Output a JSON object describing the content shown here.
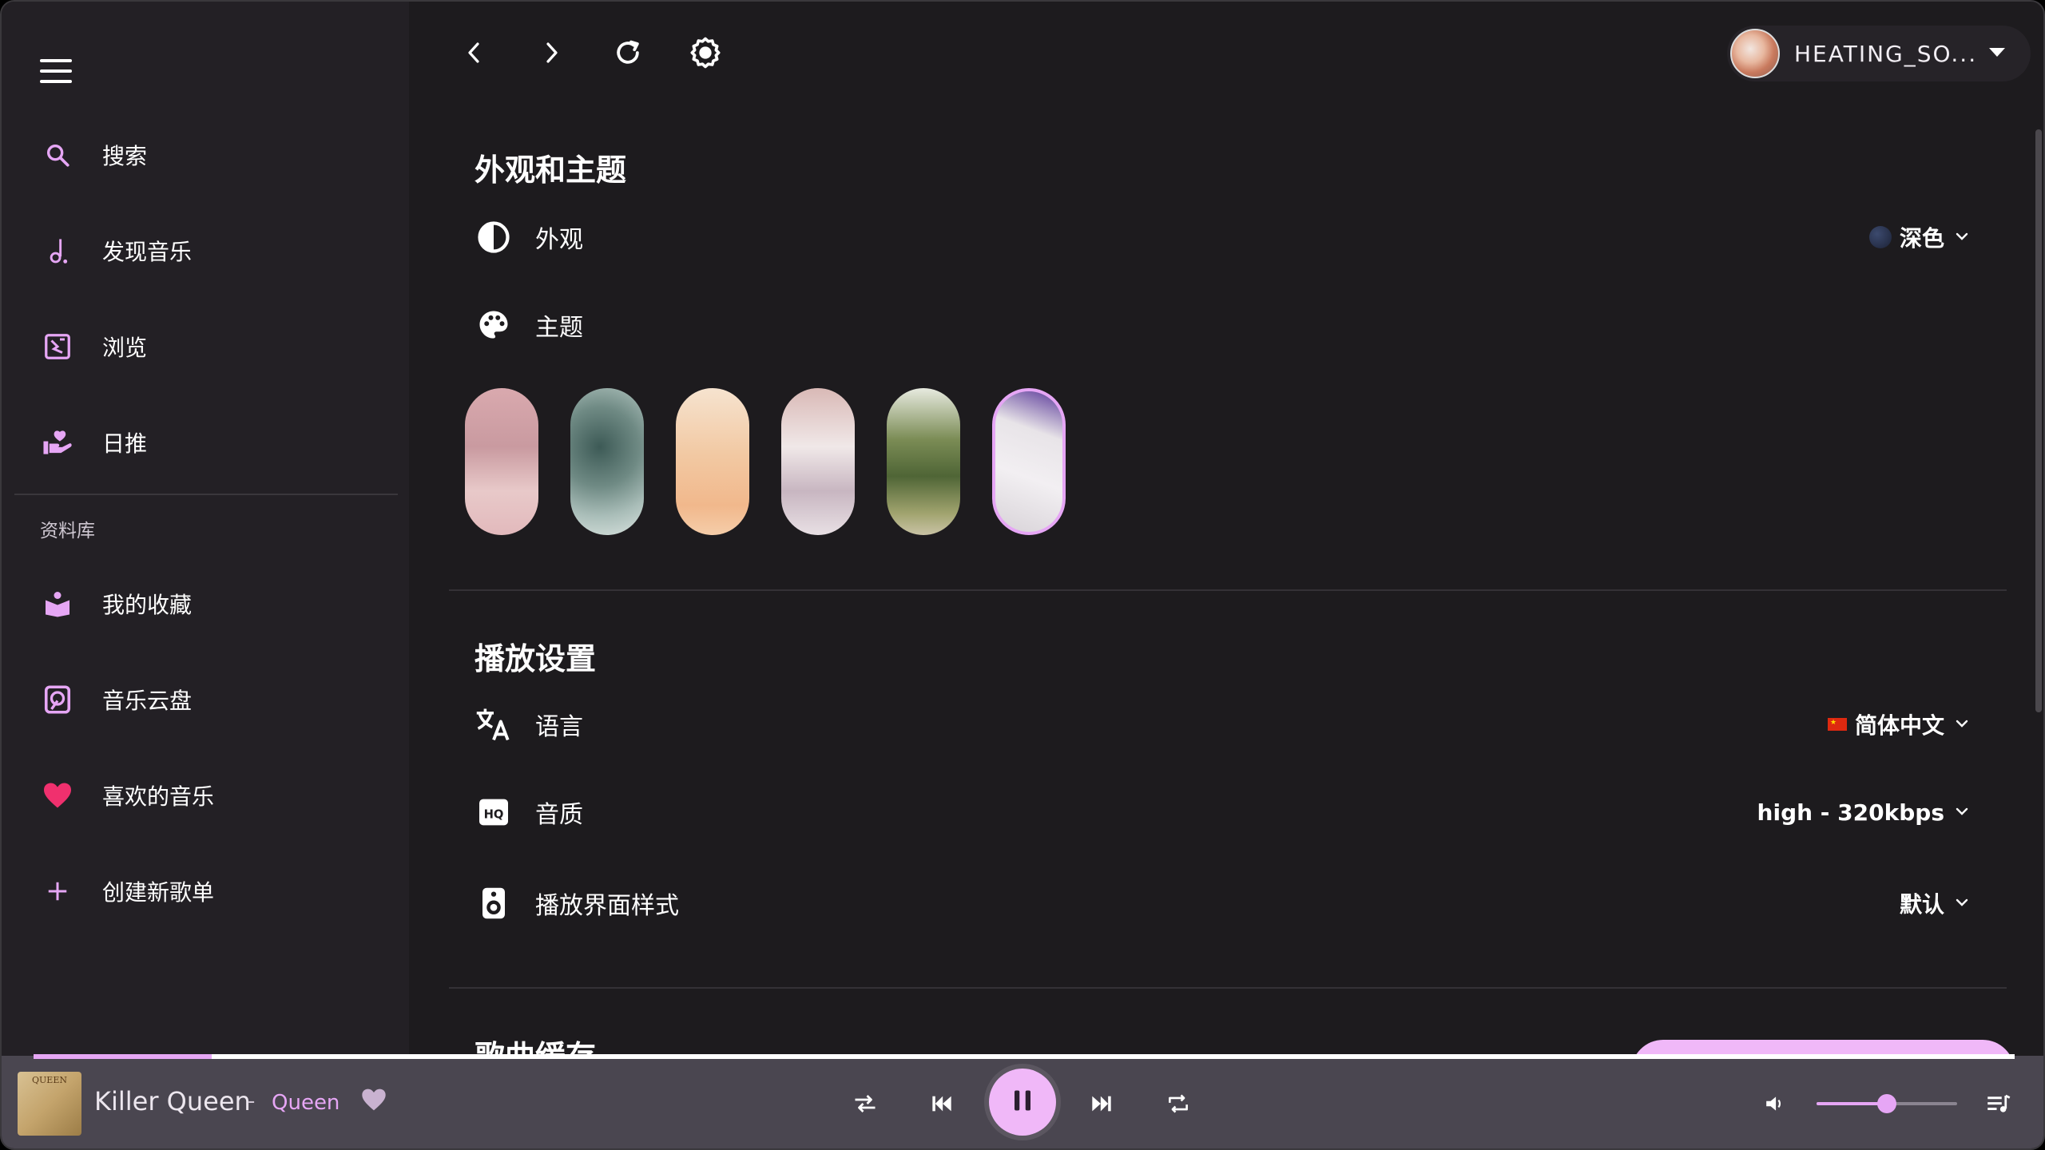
{
  "window": {
    "controls": [
      "close",
      "minimize",
      "maximize"
    ]
  },
  "sidebar": {
    "items": [
      {
        "label": "搜索",
        "icon": "search-icon"
      },
      {
        "label": "发现音乐",
        "icon": "music-note-icon"
      },
      {
        "label": "浏览",
        "icon": "browse-icon"
      },
      {
        "label": "日推",
        "icon": "daily-recommend-icon"
      }
    ],
    "library_title": "资料库",
    "library_items": [
      {
        "label": "我的收藏",
        "icon": "collection-icon"
      },
      {
        "label": "音乐云盘",
        "icon": "cloud-drive-icon"
      },
      {
        "label": "喜欢的音乐",
        "icon": "heart-icon"
      },
      {
        "label": "创建新歌单",
        "icon": "plus-icon"
      }
    ]
  },
  "topbar": {
    "buttons": [
      "back-icon",
      "forward-icon",
      "refresh-icon",
      "settings-icon"
    ],
    "user_name": "HEATING_SO..."
  },
  "appearance": {
    "section_title": "外观和主题",
    "appearance_label": "外观",
    "appearance_value": "深色",
    "theme_label": "主题",
    "themes_count": 6,
    "selected_theme": 6
  },
  "playback": {
    "section_title": "播放设置",
    "language_label": "语言",
    "language_value": "简体中文",
    "quality_label": "音质",
    "quality_value": "high - 320kbps",
    "player_style_label": "播放界面样式",
    "player_style_value": "默认"
  },
  "cache": {
    "section_title": "歌曲缓存"
  },
  "player": {
    "cover_text": "QUEEN",
    "title": "Killer Queen",
    "separator": "-",
    "artist": "Queen",
    "progress": 0.09,
    "volume": 0.5,
    "state": "playing"
  },
  "colors": {
    "accent": "#e6a6f5",
    "accent_strong": "#f0b8f8",
    "background": "#1d1b1e",
    "sidebar": "#232025",
    "player": "#4a4650",
    "heart": "#f0306e"
  }
}
